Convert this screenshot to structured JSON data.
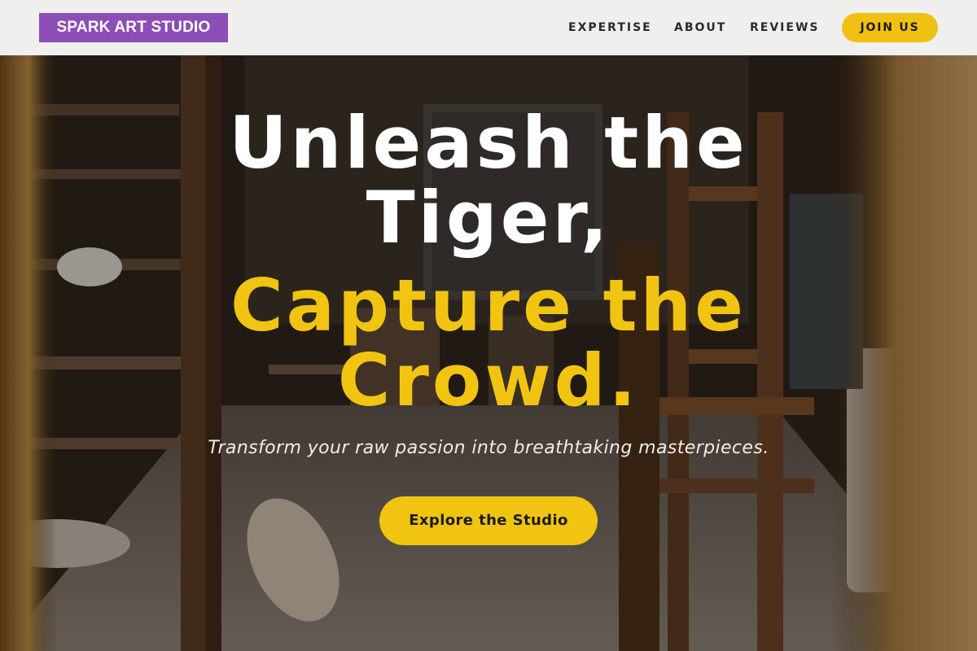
{
  "header": {
    "logo": "SPARK ART STUDIO",
    "nav": [
      {
        "label": "EXPERTISE"
      },
      {
        "label": "ABOUT"
      },
      {
        "label": "REVIEWS"
      }
    ],
    "join_label": "JOIN US"
  },
  "hero": {
    "headline_white": [
      "Unleash the",
      "Tiger,"
    ],
    "headline_yellow": [
      "Capture the",
      "Crowd."
    ],
    "subtitle": "Transform your raw passion into breathtaking masterpieces.",
    "cta_label": "Explore the Studio"
  },
  "colors": {
    "logo_bg": "#8c4eb6",
    "accent": "#f1c411",
    "header_bg": "#efefee"
  }
}
